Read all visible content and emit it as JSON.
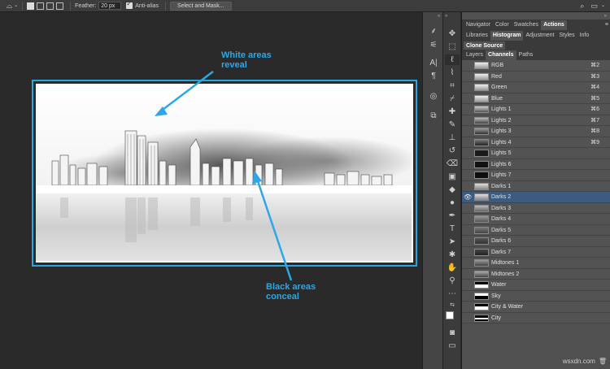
{
  "options_bar": {
    "feather_label": "Feather:",
    "feather_value": "20 px",
    "anti_alias_label": "Anti-alias",
    "select_mask_button": "Select and Mask..."
  },
  "annotations": {
    "white_line1": "White areas",
    "white_line2": "reveal",
    "black_line1": "Black areas",
    "black_line2": "conceal"
  },
  "panels": {
    "row1_tabs": [
      "Navigator",
      "Color",
      "Swatches",
      "Actions"
    ],
    "row1_active": 3,
    "row2_tabs": [
      "Libraries",
      "Histogram",
      "Adjustment",
      "Styles",
      "Info"
    ],
    "row2_active": 1,
    "row3_tabs": [
      "Clone Source"
    ],
    "row3_active": 0,
    "row4_tabs": [
      "Layers",
      "Channels",
      "Paths"
    ],
    "row4_active": 1
  },
  "channels": [
    {
      "name": "RGB",
      "key": "⌘2"
    },
    {
      "name": "Red",
      "key": "⌘3"
    },
    {
      "name": "Green",
      "key": "⌘4"
    },
    {
      "name": "Blue",
      "key": "⌘5"
    },
    {
      "name": "Lights 1",
      "key": "⌘6"
    },
    {
      "name": "Lights 2",
      "key": "⌘7"
    },
    {
      "name": "Lights 3",
      "key": "⌘8"
    },
    {
      "name": "Lights 4",
      "key": "⌘9"
    },
    {
      "name": "Lights 5",
      "key": ""
    },
    {
      "name": "Lights 6",
      "key": ""
    },
    {
      "name": "Lights 7",
      "key": ""
    },
    {
      "name": "Darks 1",
      "key": ""
    },
    {
      "name": "Darks 2",
      "key": "",
      "selected": true
    },
    {
      "name": "Darks 3",
      "key": ""
    },
    {
      "name": "Darks 4",
      "key": ""
    },
    {
      "name": "Darks 5",
      "key": ""
    },
    {
      "name": "Darks 6",
      "key": ""
    },
    {
      "name": "Darks 7",
      "key": ""
    },
    {
      "name": "Midtones 1",
      "key": ""
    },
    {
      "name": "Midtones 2",
      "key": ""
    },
    {
      "name": "Water",
      "key": ""
    },
    {
      "name": "Sky",
      "key": ""
    },
    {
      "name": "City & Water",
      "key": ""
    },
    {
      "name": "City",
      "key": ""
    }
  ],
  "watermark": "wsxdn.com",
  "colors": {
    "accent": "#2aa5e0",
    "selection": "#3d5b7f",
    "ui_bg": "#2a2a2a"
  }
}
